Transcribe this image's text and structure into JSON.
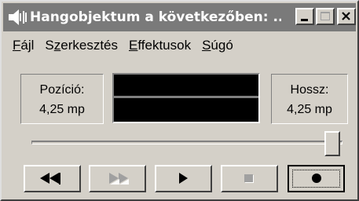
{
  "window": {
    "title": "Hangobjektum a következőben: ..."
  },
  "menu": {
    "items": [
      {
        "label": "Fájl",
        "underline": "F",
        "rest": "ájl"
      },
      {
        "label": "Szerkesztés",
        "first": "S",
        "underline": "z",
        "rest": "erkesztés"
      },
      {
        "label": "Effektusok",
        "underline": "E",
        "rest": "ffektusok"
      },
      {
        "label": "Súgó",
        "underline": "S",
        "rest": "úgó"
      }
    ]
  },
  "position": {
    "label": "Pozíció:",
    "value": "4,25 mp"
  },
  "length": {
    "label": "Hossz:",
    "value": "4,25 mp"
  },
  "slider": {
    "level": 1.0
  },
  "controls": {
    "rewind_icon": "rewind-icon",
    "forward_icon": "fast-forward-icon",
    "play_icon": "play-icon",
    "stop_icon": "stop-icon",
    "record_icon": "record-icon"
  },
  "colors": {
    "face": "#d4d0c8",
    "titlebar": "#7a7a7a",
    "disabled": "#a0a0a0"
  }
}
